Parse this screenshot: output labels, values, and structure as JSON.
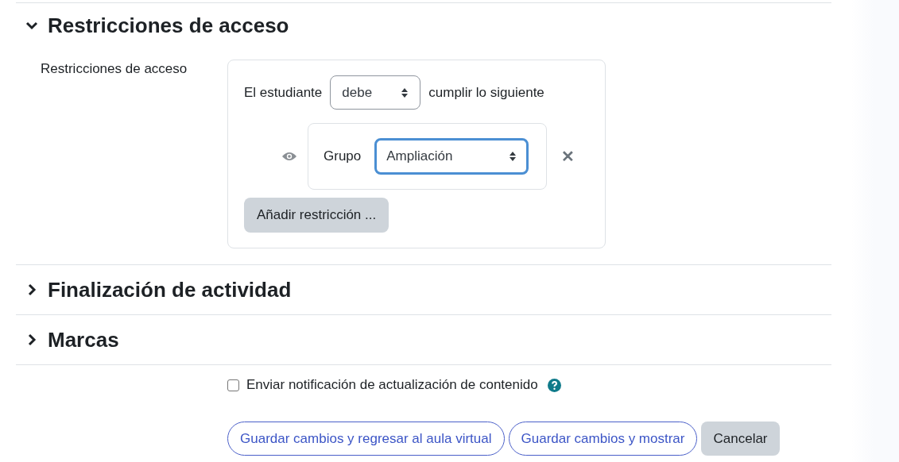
{
  "sections": [
    {
      "title": "Restricciones de acceso",
      "expanded": true
    },
    {
      "title": "Finalización de actividad",
      "expanded": false
    },
    {
      "title": "Marcas",
      "expanded": false
    }
  ],
  "access": {
    "label": "Restricciones de acceso",
    "prefix": "El estudiante",
    "mode": "debe",
    "suffix": "cumplir lo siguiente",
    "conditions": [
      {
        "visible": true,
        "label": "Grupo",
        "value": "Ampliación",
        "focused": true,
        "remove": "✕"
      }
    ],
    "add_button": "Añadir restricción ..."
  },
  "notify": {
    "label": "Enviar notificación de actualización de contenido",
    "checked": false
  },
  "buttons": [
    {
      "label": "Guardar cambios y regresar al aula virtual",
      "kind": "outline"
    },
    {
      "label": "Guardar cambios y mostrar",
      "kind": "outline"
    },
    {
      "label": "Cancelar",
      "kind": "secondary"
    }
  ]
}
